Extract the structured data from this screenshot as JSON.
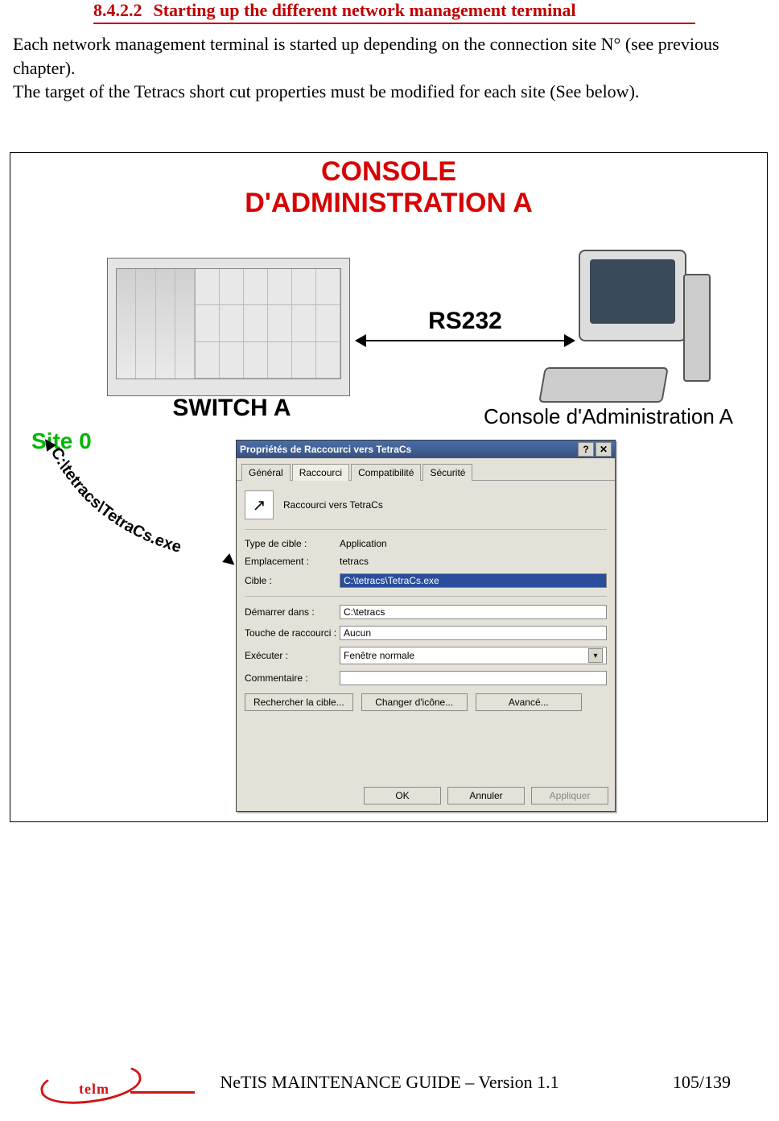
{
  "heading": {
    "number": "8.4.2.2",
    "title": "Starting up the different network management terminal"
  },
  "body": {
    "p1": "Each network management terminal is started up depending on the connection site N° (see previous chapter).",
    "p2": "The target of the Tetracs short cut properties must be modified for each site (See below)."
  },
  "diagram": {
    "console_title_line1": "CONSOLE",
    "console_title_line2": "D'ADMINISTRATION A",
    "switch_label": "SWITCH A",
    "link_label": "RS232",
    "pc_label": "Console d'Administration A",
    "site_label": "Site 0",
    "path_text": "C:\\tetracs\\TetraCs.exe"
  },
  "dialog": {
    "title": "Propriétés de Raccourci vers TetraCs",
    "help_btn": "?",
    "close_btn": "✕",
    "tabs": {
      "general": "Général",
      "shortcut": "Raccourci",
      "compat": "Compatibilité",
      "security": "Sécurité"
    },
    "icon_caption": "Raccourci vers TetraCs",
    "rows": {
      "type_label": "Type de cible :",
      "type_value": "Application",
      "location_label": "Emplacement :",
      "location_value": "tetracs",
      "target_label": "Cible :",
      "target_value": "C:\\tetracs\\TetraCs.exe",
      "startin_label": "Démarrer dans :",
      "startin_value": "C:\\tetracs",
      "hotkey_label": "Touche de raccourci :",
      "hotkey_value": "Aucun",
      "run_label": "Exécuter :",
      "run_value": "Fenêtre normale",
      "comment_label": "Commentaire :",
      "comment_value": ""
    },
    "action_buttons": {
      "find": "Rechercher la cible...",
      "icon": "Changer d'icône...",
      "advanced": "Avancé..."
    },
    "bottom_buttons": {
      "ok": "OK",
      "cancel": "Annuler",
      "apply": "Appliquer"
    }
  },
  "footer": {
    "logo_text": "telm",
    "doc_title": "NeTIS MAINTENANCE GUIDE – Version 1.1",
    "page": "105/139"
  }
}
